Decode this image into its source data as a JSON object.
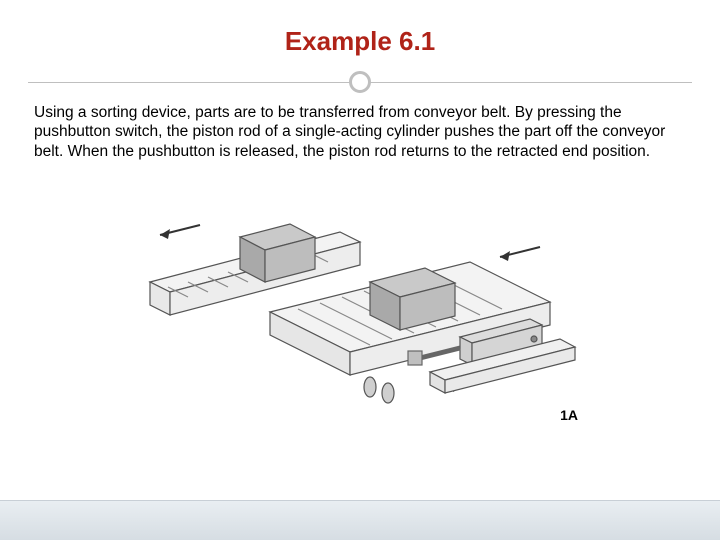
{
  "title": "Example 6.1",
  "body": "Using a sorting device, parts are to be transferred from conveyor belt. By pressing the pushbutton switch, the piston rod of a single-acting cylinder pushes the part off the conveyor belt. When the pushbutton is released, the piston rod returns to the retracted end position.",
  "figure": {
    "label": "1A",
    "description": "Isometric sketch: two conveyor belts at right angles with roller surfaces; two grey box parts on the belts; a single-acting pneumatic cylinder (labelled 1A) mounted to push parts from one belt to the other. Arrows indicate belt travel directions and piston stroke."
  }
}
